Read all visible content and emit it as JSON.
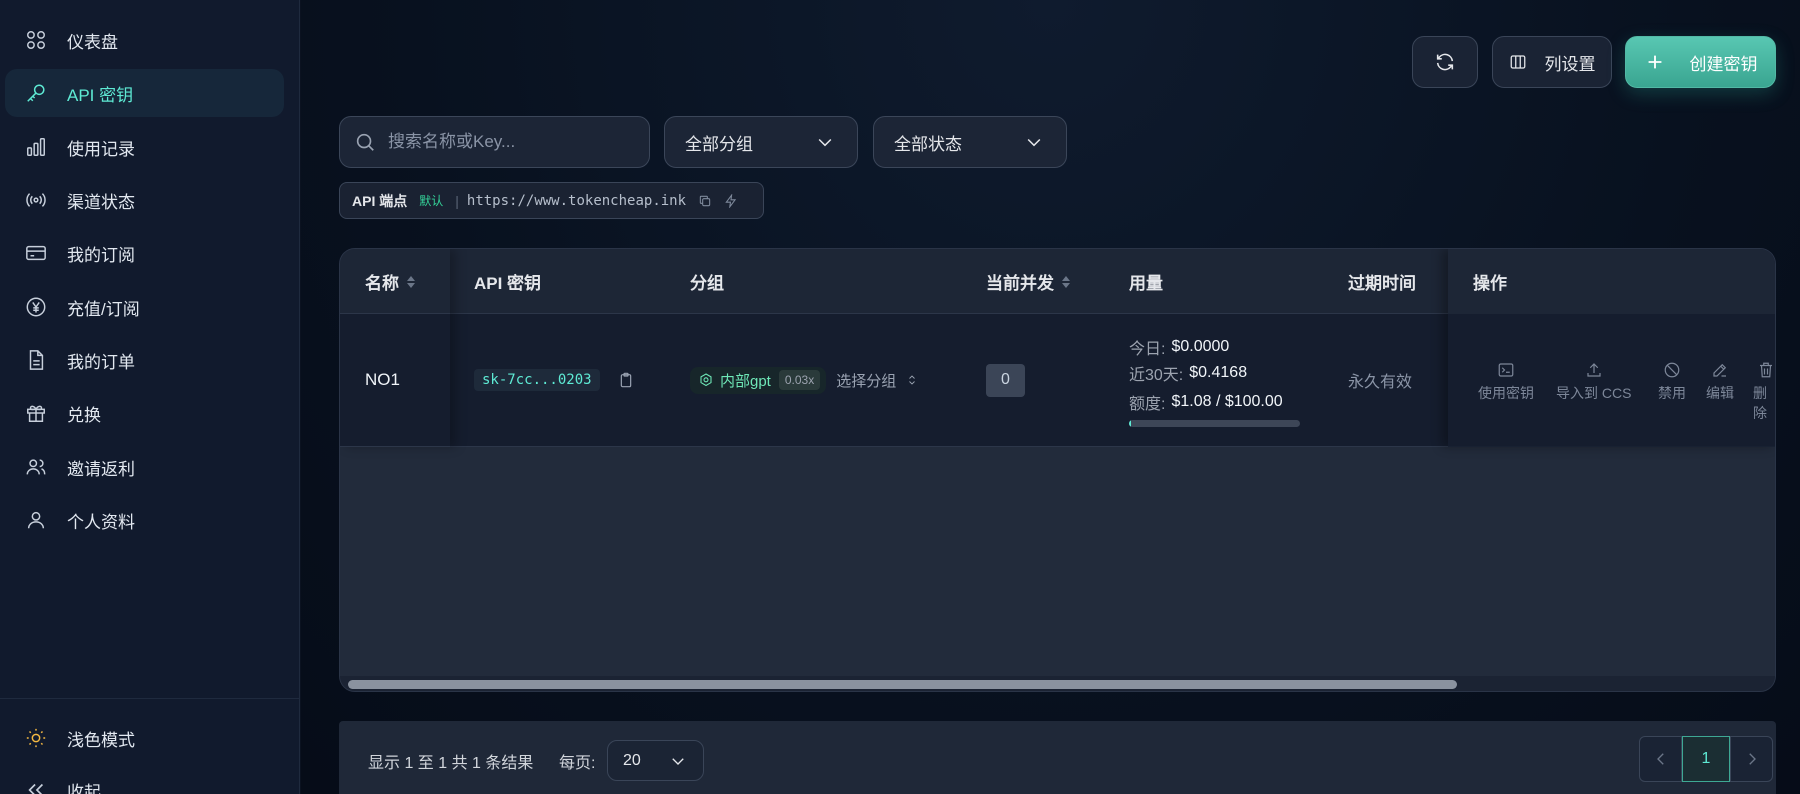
{
  "sidebar": {
    "items": [
      {
        "label": "仪表盘",
        "icon": "grid-icon",
        "active": false
      },
      {
        "label": "API 密钥",
        "icon": "key-icon",
        "active": true
      },
      {
        "label": "使用记录",
        "icon": "bar-chart-icon",
        "active": false
      },
      {
        "label": "渠道状态",
        "icon": "broadcast-icon",
        "active": false
      },
      {
        "label": "我的订阅",
        "icon": "credit-card-icon",
        "active": false
      },
      {
        "label": "充值/订阅",
        "icon": "yen-coin-icon",
        "active": false
      },
      {
        "label": "我的订单",
        "icon": "document-icon",
        "active": false
      },
      {
        "label": "兑换",
        "icon": "gift-icon",
        "active": false
      },
      {
        "label": "邀请返利",
        "icon": "users-icon",
        "active": false
      },
      {
        "label": "个人资料",
        "icon": "user-icon",
        "active": false
      }
    ],
    "theme_toggle": "浅色模式",
    "collapse": "收起"
  },
  "toolbar": {
    "columns_label": "列设置",
    "create_label": "创建密钥"
  },
  "filters": {
    "search_placeholder": "搜索名称或Key...",
    "group_select": "全部分组",
    "status_select": "全部状态"
  },
  "endpoint": {
    "label": "API 端点",
    "badge": "默认",
    "separator": "|",
    "url": "https://www.tokencheap.ink"
  },
  "table": {
    "headers": {
      "name": "名称",
      "key": "API 密钥",
      "group": "分组",
      "concurrency": "当前并发",
      "usage": "用量",
      "expiry": "过期时间",
      "actions": "操作"
    },
    "rows": [
      {
        "name": "NO1",
        "key": "sk-7cc...0203",
        "group": "内部gpt",
        "group_rate": "0.03x",
        "select_group": "选择分组",
        "concurrency": "0",
        "today_label": "今日:",
        "today_value": "$0.0000",
        "month_label": "近30天:",
        "month_value": "$0.4168",
        "quota_label": "额度:",
        "quota_value": "$1.08 / $100.00",
        "quota_fraction": 0.0108,
        "expiry": "永久有效",
        "actions": [
          "使用密钥",
          "导入到 CCS",
          "禁用",
          "编辑",
          "删除"
        ]
      }
    ]
  },
  "footer": {
    "summary": "显示 1 至 1 共 1 条结果",
    "per_page_label": "每页:",
    "per_page_value": "20",
    "current_page": "1"
  },
  "colors": {
    "accent": "#5eead4",
    "primary_button": "#4fb9a4",
    "background": "#0b1220",
    "sidebar": "#111a2d"
  }
}
